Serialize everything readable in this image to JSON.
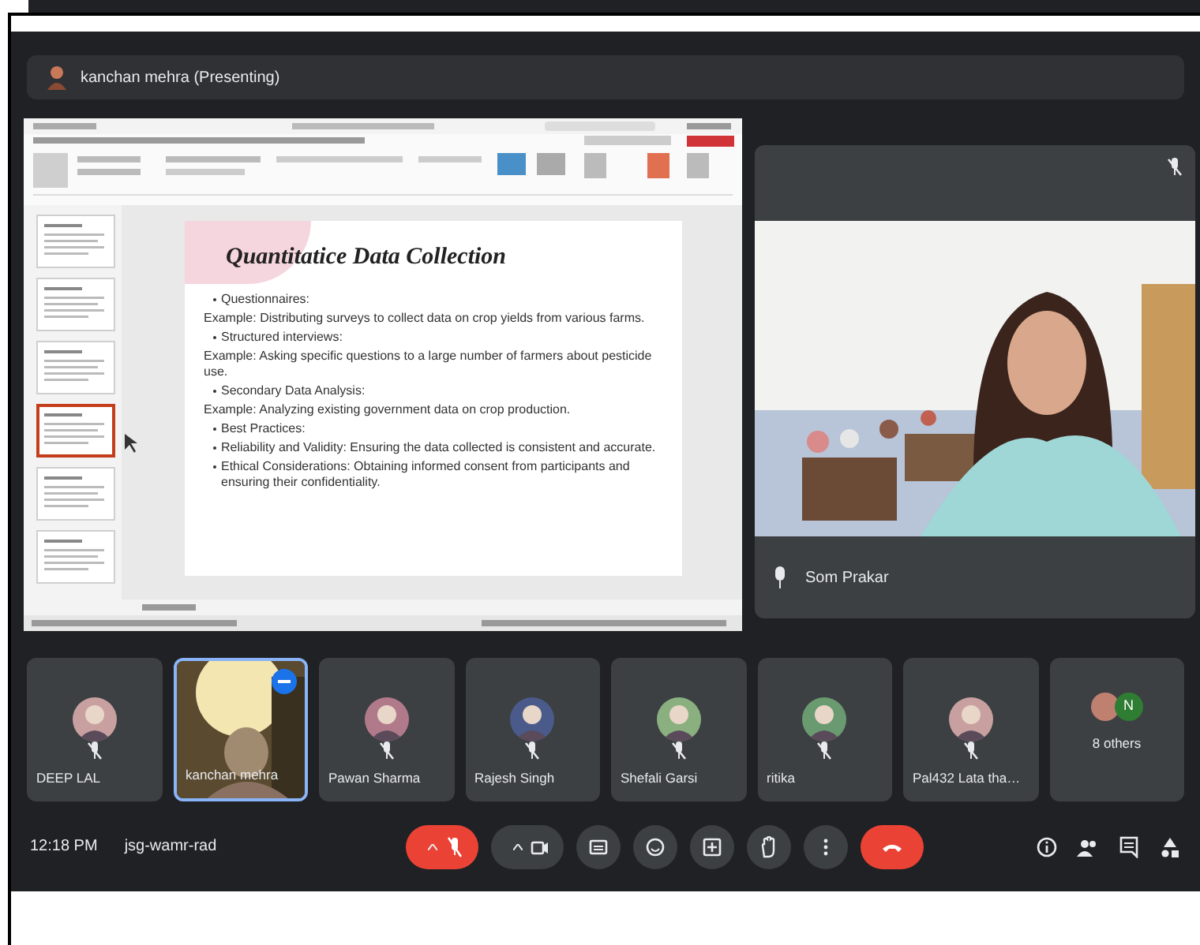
{
  "presenter_bar": {
    "label": "kanchan mehra (Presenting)"
  },
  "shared_screen": {
    "slide_thumbnails": [
      {
        "selected": false
      },
      {
        "selected": false
      },
      {
        "selected": false
      },
      {
        "selected": true
      },
      {
        "selected": false
      },
      {
        "selected": false
      }
    ],
    "slide": {
      "title": "Quantitatice Data Collection",
      "lines": [
        {
          "kind": "bullet",
          "text": "Questionnaires:"
        },
        {
          "kind": "plain",
          "text": "Example: Distributing surveys to collect data on crop yields from various farms."
        },
        {
          "kind": "bullet",
          "text": "Structured interviews:"
        },
        {
          "kind": "plain",
          "text": "Example: Asking specific questions to a large number of farmers about pesticide use."
        },
        {
          "kind": "bullet",
          "text": "Secondary Data Analysis:"
        },
        {
          "kind": "plain",
          "text": "Example: Analyzing existing government data on crop production."
        },
        {
          "kind": "bullet",
          "text": "Best Practices:"
        },
        {
          "kind": "bullet",
          "text": "Reliability and Validity: Ensuring the data collected is consistent and accurate."
        },
        {
          "kind": "bullet",
          "text": "Ethical Considerations: Obtaining informed consent from participants and ensuring their confidentiality."
        }
      ]
    }
  },
  "spotlight": {
    "name": "Som Prakar",
    "muted": true
  },
  "participants": [
    {
      "kind": "avatar",
      "name": "DEEP LAL",
      "muted": true,
      "highlighted": false
    },
    {
      "kind": "video",
      "name": "kanchan mehra",
      "muted": false,
      "highlighted": true
    },
    {
      "kind": "avatar",
      "name": "Pawan Sharma",
      "muted": true,
      "highlighted": false
    },
    {
      "kind": "avatar",
      "name": "Rajesh Singh",
      "muted": true,
      "highlighted": false
    },
    {
      "kind": "avatar",
      "name": "Shefali Garsi",
      "muted": true,
      "highlighted": false
    },
    {
      "kind": "avatar",
      "name": "ritika",
      "muted": true,
      "highlighted": false
    },
    {
      "kind": "avatar",
      "name": "Pal432 Lata tha…",
      "muted": true,
      "highlighted": false
    },
    {
      "kind": "others",
      "name": "8 others",
      "initial": "N",
      "muted": false,
      "highlighted": false
    }
  ],
  "bottom_bar": {
    "time": "12:18 PM",
    "meeting_code": "jsg-wamr-rad",
    "controls": [
      {
        "kind": "mic",
        "on": false
      },
      {
        "kind": "camera"
      },
      {
        "kind": "captions"
      },
      {
        "kind": "emoji"
      },
      {
        "kind": "present"
      },
      {
        "kind": "hand"
      },
      {
        "kind": "more"
      },
      {
        "kind": "leave"
      }
    ],
    "side_icons": [
      {
        "kind": "info"
      },
      {
        "kind": "people"
      },
      {
        "kind": "chat"
      },
      {
        "kind": "activities"
      }
    ]
  }
}
